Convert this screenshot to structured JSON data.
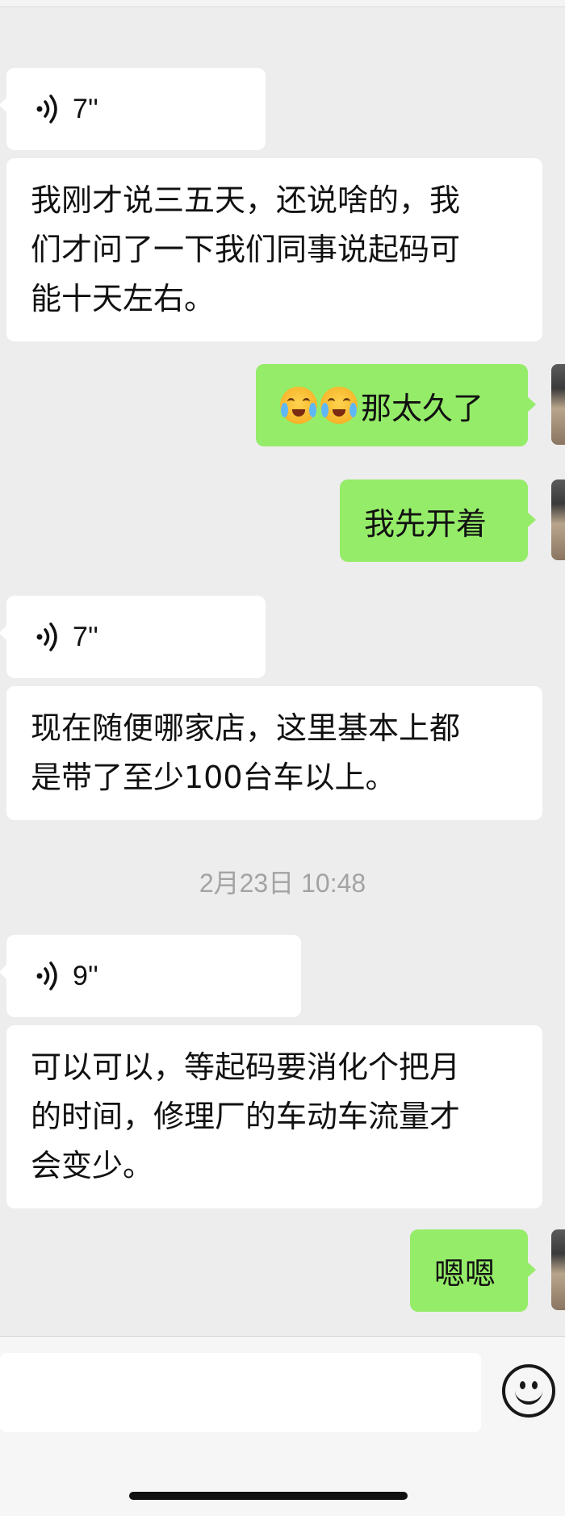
{
  "messages": [
    {
      "type": "voice",
      "duration": "7''"
    },
    {
      "type": "text",
      "lines": [
        "我刚才说三五天，还说啥的，我",
        "们才问了一下我们同事说起码可",
        "能十天左右。"
      ]
    },
    {
      "type": "sent",
      "text": "那太久了"
    },
    {
      "type": "sent",
      "text": "我先开着"
    },
    {
      "type": "voice",
      "duration": "7''"
    },
    {
      "type": "text",
      "lines": [
        "现在随便哪家店，这里基本上都",
        "是带了至少100台车以上。"
      ]
    },
    {
      "type": "voice",
      "duration": "9''"
    },
    {
      "type": "text",
      "lines": [
        "可以可以，等起码要消化个把月",
        "的时间，修理厂的车动车流量才",
        "会变少。"
      ]
    },
    {
      "type": "sent",
      "text": "嗯嗯"
    }
  ],
  "timestamp": "2月23日 10:48",
  "icons": {
    "voice": "voice-wave-icon",
    "emoji": "emoji-face-icon",
    "sent_emoji": "facepalm-crying-emoji"
  },
  "colors": {
    "background": "#ededed",
    "incoming": "#ffffff",
    "outgoing": "#95ec69",
    "timestamp": "#a3a3a3"
  }
}
